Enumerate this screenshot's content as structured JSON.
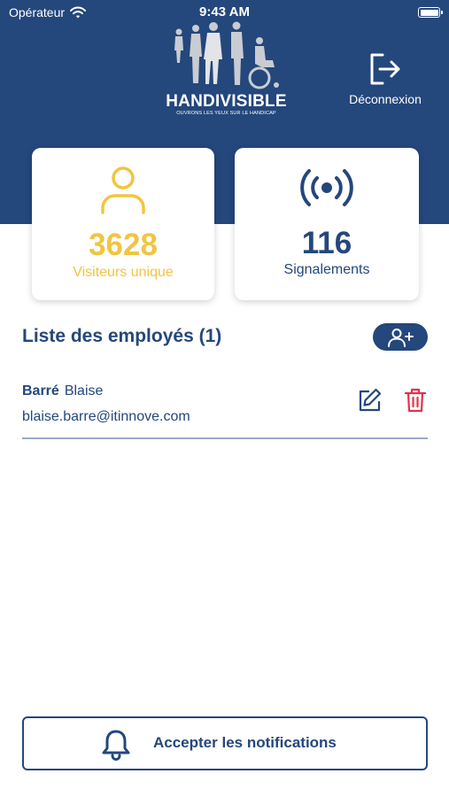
{
  "status_bar": {
    "carrier": "Opérateur",
    "time": "9:43 AM",
    "battery_level": 1.0
  },
  "header": {
    "logo": {
      "title": "HANDIVISIBLE",
      "tagline": "OUVRONS LES YEUX SUR LE HANDICAP"
    },
    "logout_label": "Déconnexion"
  },
  "stats": {
    "visitors": {
      "value": "3628",
      "label": "Visiteurs unique",
      "icon": "user-icon"
    },
    "reports": {
      "value": "116",
      "label": "Signalements",
      "icon": "broadcast-icon"
    }
  },
  "employees": {
    "title": "Liste des employés (1)",
    "add_icon": "add-user-icon",
    "items": [
      {
        "last_name": "Barré",
        "first_name": "Blaise",
        "email": "blaise.barre@itinnove.com"
      }
    ]
  },
  "notifications": {
    "label": "Accepter les notifications",
    "icon": "bell-icon"
  },
  "colors": {
    "brand": "#24477c",
    "accent": "#f0c540",
    "danger": "#e0334d",
    "divider": "#9aaac8"
  }
}
